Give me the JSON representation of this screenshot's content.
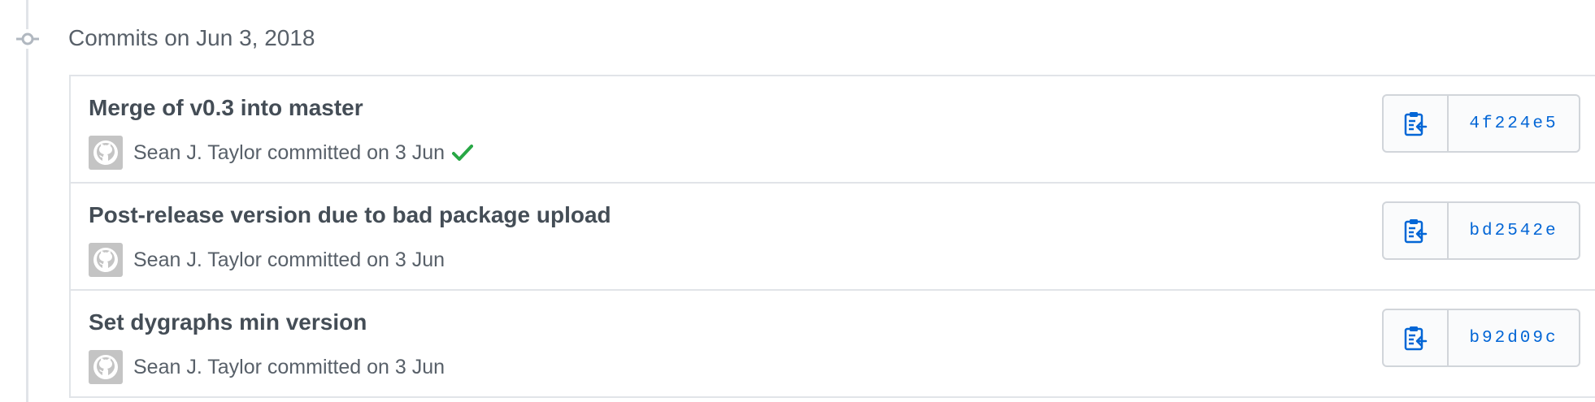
{
  "group": {
    "title": "Commits on Jun 3, 2018"
  },
  "commits": [
    {
      "message": "Merge of v0.3 into master",
      "meta": "Sean J. Taylor committed on 3 Jun",
      "verified": true,
      "sha": "4f224e5"
    },
    {
      "message": "Post-release version due to bad package upload",
      "meta": "Sean J. Taylor committed on 3 Jun",
      "verified": false,
      "sha": "bd2542e"
    },
    {
      "message": "Set dygraphs min version",
      "meta": "Sean J. Taylor committed on 3 Jun",
      "verified": false,
      "sha": "b92d09c"
    }
  ],
  "icons": {
    "timeline": "git-commit-icon",
    "avatar": "github-octocat-icon",
    "verified": "check-icon",
    "copy": "clippy-icon"
  },
  "colors": {
    "sha_link": "#0366d6",
    "verified_check": "#28a745",
    "muted_text": "#586069"
  }
}
